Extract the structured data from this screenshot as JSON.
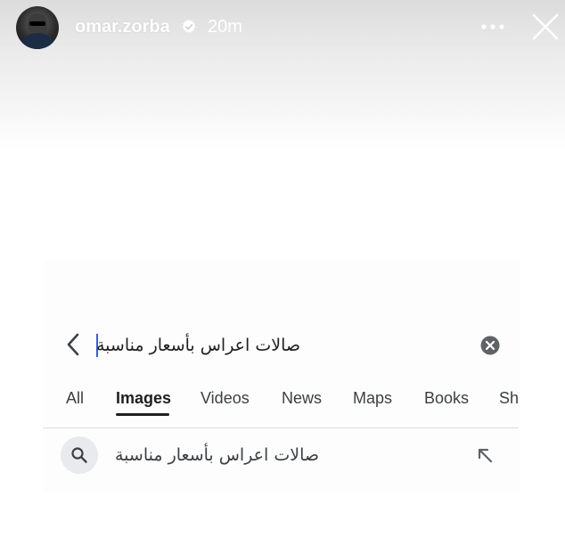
{
  "story": {
    "username": "omar.zorba",
    "time_ago": "20m",
    "icons": {
      "verified": "verified-badge-icon",
      "more": "more-dots-icon",
      "close": "close-icon"
    }
  },
  "search": {
    "query": "صالات اعراس بأسعار مناسبة",
    "icons": {
      "back": "chevron-left-icon",
      "clear": "clear-circle-icon"
    }
  },
  "tabs": [
    {
      "label": "All",
      "active": false
    },
    {
      "label": "Images",
      "active": true
    },
    {
      "label": "Videos",
      "active": false
    },
    {
      "label": "News",
      "active": false
    },
    {
      "label": "Maps",
      "active": false
    },
    {
      "label": "Books",
      "active": false
    },
    {
      "label": "Sh",
      "active": false
    }
  ],
  "suggestion": {
    "text": "صالات اعراس بأسعار مناسبة",
    "icons": {
      "search": "search-icon",
      "fill": "arrow-up-left-icon"
    }
  },
  "colors": {
    "caret": "#3b5bdb",
    "active_tab": "#1f1f1f",
    "text": "#3c4043"
  }
}
